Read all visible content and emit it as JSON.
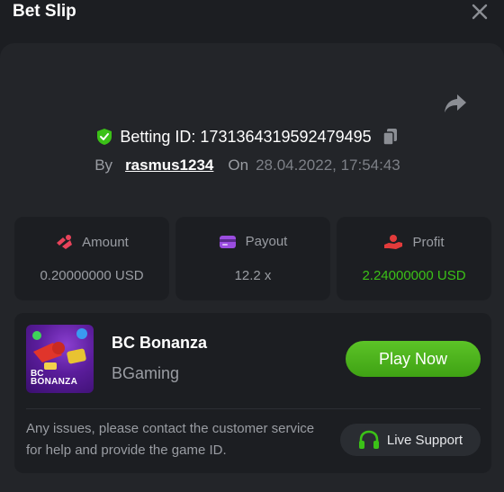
{
  "header": {
    "title": "Bet Slip"
  },
  "bet": {
    "betting_id_label": "Betting ID: 1731364319592479495",
    "by_label": "By",
    "username": "rasmus1234",
    "on_label": "On",
    "timestamp": "28.04.2022, 17:54:43"
  },
  "stats": {
    "amount": {
      "label": "Amount",
      "value": "0.20000000 USD"
    },
    "payout": {
      "label": "Payout",
      "value": "12.2 x"
    },
    "profit": {
      "label": "Profit",
      "value": "2.24000000 USD"
    }
  },
  "game": {
    "name": "BC Bonanza",
    "provider": "BGaming",
    "thumbnail_text": "BONANZA",
    "thumbnail_prefix": "BC",
    "play_label": "Play Now"
  },
  "support": {
    "note": "Any issues, please contact the customer service for help and provide the game ID.",
    "button_label": "Live Support"
  },
  "colors": {
    "background": "#1c1e22",
    "panel": "#232529",
    "accent_green": "#3bc117",
    "button_green": "#4caf1e",
    "amount_icon": "#e8435a",
    "payout_icon": "#9b4de0",
    "profit_icon": "#e33b3b"
  },
  "icons": {
    "close": "close-icon",
    "share": "share-icon",
    "verified": "shield-check-icon",
    "copy": "copy-icon",
    "amount": "bet-amount-icon",
    "payout": "card-icon",
    "profit": "hand-coin-icon",
    "support": "headset-icon"
  }
}
